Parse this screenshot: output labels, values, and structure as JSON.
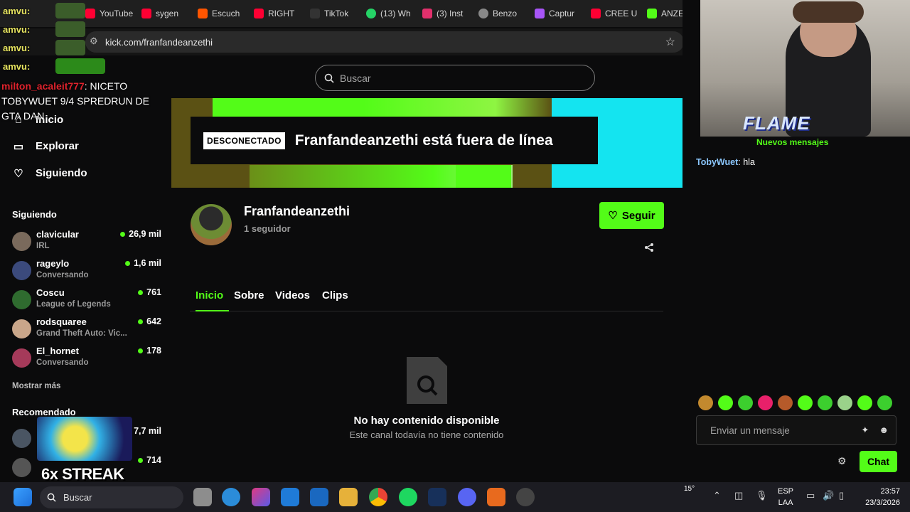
{
  "bookmarks": [
    {
      "label": "YouTube",
      "color": "#ff0033"
    },
    {
      "label": "sygen",
      "color": "#ff0033"
    },
    {
      "label": "Escuch",
      "color": "#ff5500"
    },
    {
      "label": "RIGHT",
      "color": "#ff0033"
    },
    {
      "label": "TikTok",
      "color": "#222222"
    },
    {
      "label": "(13) Wh",
      "color": "#25d366"
    },
    {
      "label": "(3) Inst",
      "color": "#e1306c"
    },
    {
      "label": "Benzo",
      "color": "#888888"
    },
    {
      "label": "Captur",
      "color": "#a855f7"
    },
    {
      "label": "CREE U",
      "color": "#ff0033"
    },
    {
      "label": "ANZET",
      "color": "#53fc18"
    }
  ],
  "address": {
    "url": "kick.com/franfandeanzethi"
  },
  "search": {
    "placeholder": "Buscar"
  },
  "nav": {
    "home": "Inicio",
    "explore": "Explorar",
    "following": "Siguiendo"
  },
  "following_section": {
    "title": "Siguiendo",
    "channels": [
      {
        "name": "clavicular",
        "category": "IRL",
        "viewers": "26,9 mil",
        "avatar": "#7a6a5c"
      },
      {
        "name": "rageylo",
        "category": "Conversando",
        "viewers": "1,6 mil",
        "avatar": "#3b4a7c"
      },
      {
        "name": "Coscu",
        "category": "League of Legends",
        "viewers": "761",
        "avatar": "#2f6b2f"
      },
      {
        "name": "rodsquaree",
        "category": "Grand Theft Auto: Vic...",
        "viewers": "642",
        "avatar": "#c9a68a"
      },
      {
        "name": "El_hornet",
        "category": "Conversando",
        "viewers": "178",
        "avatar": "#a53a5a"
      }
    ],
    "show_more": "Mostrar más"
  },
  "recommended_section": {
    "title": "Recomendado",
    "channels": [
      {
        "viewers": "7,7 mil",
        "avatar": "#4a5563"
      },
      {
        "viewers": "714",
        "avatar": "#555555"
      }
    ]
  },
  "banner": {
    "badge": "DESCONECTADO",
    "text": "Franfandeanzethi está fuera de línea"
  },
  "profile": {
    "name": "Franfandeanzethi",
    "followers": "1 seguidor",
    "follow_label": "Seguir"
  },
  "tabs": [
    "Inicio",
    "Sobre",
    "Videos",
    "Clips"
  ],
  "empty": {
    "title": "No hay contenido disponible",
    "subtitle": "Este canal todavía no tiene contenido"
  },
  "chat": {
    "new_messages": "Nuevos mensajes",
    "messages": [
      {
        "user": "TobyWuet",
        "text": "hla"
      }
    ],
    "input_placeholder": "Enviar un mensaje",
    "chat_button": "Chat"
  },
  "overlay": {
    "chat_user": "amvu:",
    "message_user": "milton_acaleit777",
    "message_text": ": NICETO TOBYWUET 9/4 SPREDRUN DE GTA DAN",
    "streak": "6x STREAK",
    "flame_logo": "FLAME"
  },
  "taskbar": {
    "search": "Buscar",
    "weather": "15°",
    "lang_top": "ESP",
    "lang_bottom": "LAA",
    "time": "23:57",
    "date": "23/3/2026"
  },
  "colors": {
    "accent": "#53fc18",
    "background": "#0b0b0c"
  }
}
